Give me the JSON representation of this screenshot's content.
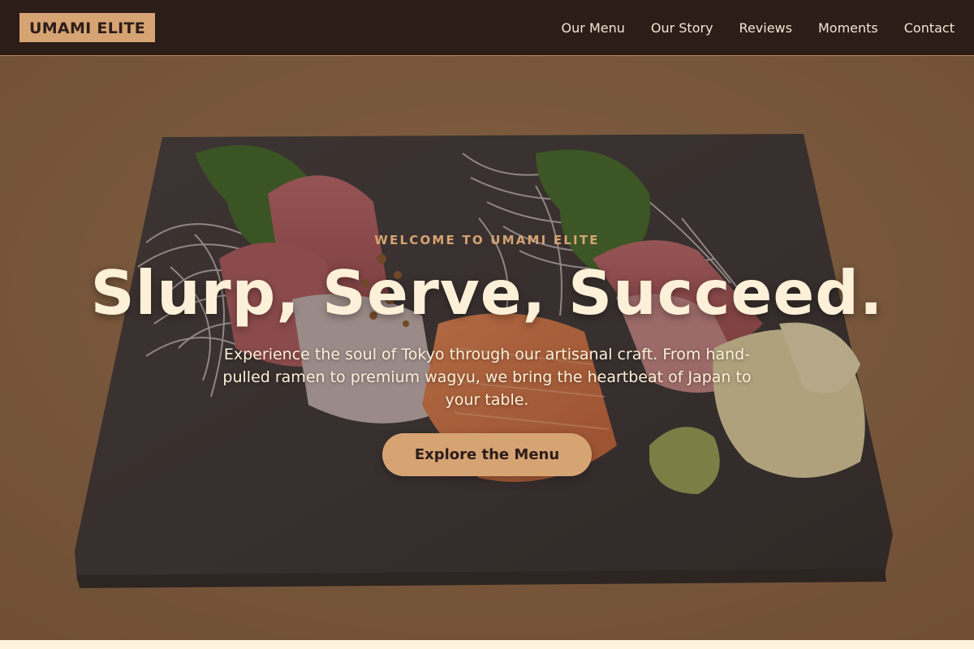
{
  "brand": {
    "name": "UMAMI ELITE"
  },
  "nav": {
    "links": [
      {
        "label": "Our Menu"
      },
      {
        "label": "Our Story"
      },
      {
        "label": "Reviews"
      },
      {
        "label": "Moments"
      },
      {
        "label": "Contact"
      }
    ]
  },
  "hero": {
    "eyebrow": "WELCOME TO UMAMI ELITE",
    "title": "Slurp, Serve, Succeed.",
    "description": "Experience the soul of Tokyo through our artisanal craft. From hand-pulled ramen to premium wagyu, we bring the heartbeat of Japan to your table.",
    "cta_label": "Explore the Menu"
  },
  "colors": {
    "nav_bg": "#2c1d19",
    "accent": "#d6a373",
    "cream": "#fdf0d8",
    "page_bg": "#fdf3dc"
  }
}
